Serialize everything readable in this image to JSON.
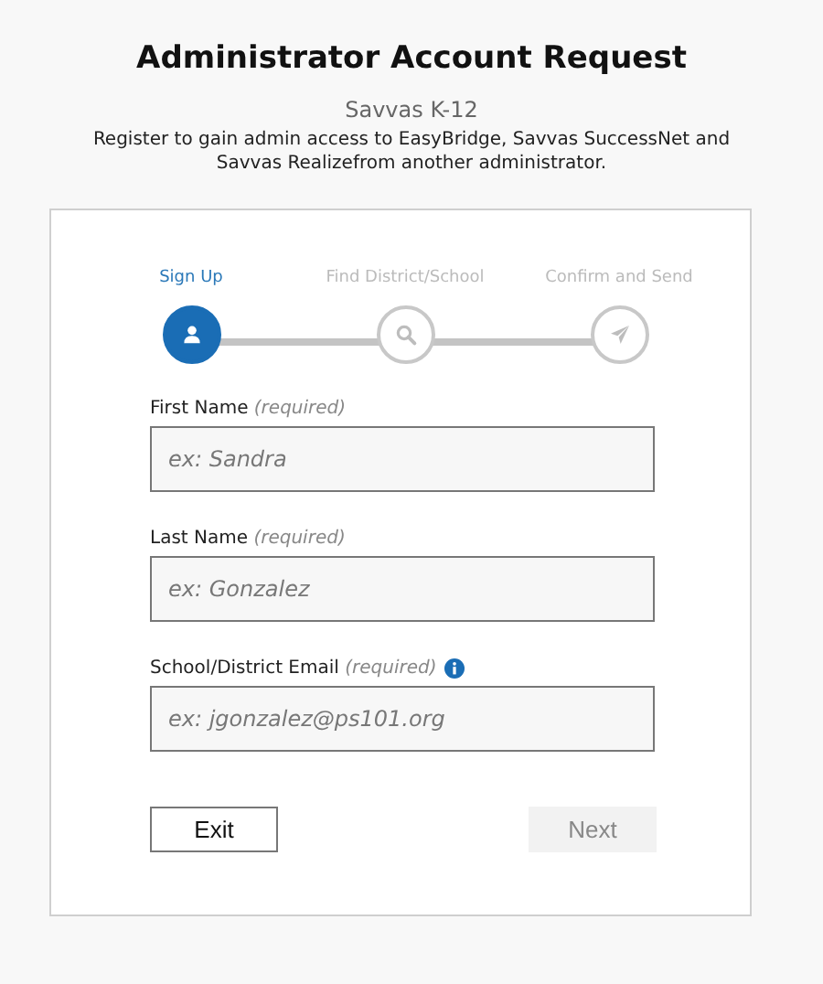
{
  "title": "Administrator Account Request",
  "subtitle": "Savvas K-12",
  "description": "Register to gain admin access to EasyBridge, Savvas SuccessNet and Savvas Realizefrom another administrator.",
  "steps": [
    {
      "label": "Sign Up",
      "kind": "person",
      "selected": true
    },
    {
      "label": "Find District/School",
      "kind": "search",
      "selected": false
    },
    {
      "label": "Confirm and Send",
      "kind": "send",
      "selected": false
    }
  ],
  "fields": [
    {
      "label": "First Name",
      "note": "(required)",
      "placeholder": "ex: Sandra",
      "info": false
    },
    {
      "label": "Last Name",
      "note": "(required)",
      "placeholder": "ex: Gonzalez",
      "info": false
    },
    {
      "label": "School/District Email",
      "note": "(required)",
      "placeholder": "ex: jgonzalez@ps101.org",
      "info": true
    }
  ],
  "buttons": [
    {
      "label": "Exit",
      "disabled": false
    },
    {
      "label": "Next",
      "disabled": true
    }
  ]
}
